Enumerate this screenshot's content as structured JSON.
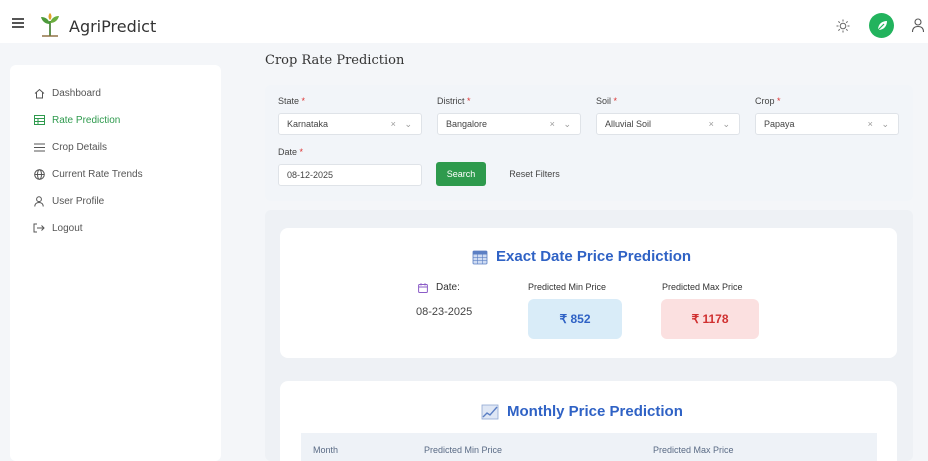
{
  "app": {
    "brand": "AgriPredict"
  },
  "icons": {
    "menu": "hamburger-icon",
    "logo": "sprout-icon",
    "theme": "sun-icon",
    "avatar": "plant-icon",
    "user": "user-icon"
  },
  "colors": {
    "accent_green": "#2e9a4d",
    "title_blue": "#2f62c5",
    "max_red": "#d03030"
  },
  "sidebar": {
    "items": [
      {
        "label": "Dashboard",
        "icon": "home-icon",
        "active": false
      },
      {
        "label": "Rate Prediction",
        "icon": "table-icon",
        "active": true
      },
      {
        "label": "Crop Details",
        "icon": "list-icon",
        "active": false
      },
      {
        "label": "Current Rate Trends",
        "icon": "globe-icon",
        "active": false
      },
      {
        "label": "User Profile",
        "icon": "user-icon",
        "active": false
      },
      {
        "label": "Logout",
        "icon": "logout-icon",
        "active": false
      }
    ]
  },
  "page": {
    "title": "Crop Rate Prediction"
  },
  "filters": {
    "state": {
      "label": "State",
      "value": "Karnataka"
    },
    "district": {
      "label": "District",
      "value": "Bangalore"
    },
    "soil": {
      "label": "Soil",
      "value": "Alluvial Soil"
    },
    "crop": {
      "label": "Crop",
      "value": "Papaya"
    },
    "date": {
      "label": "Date",
      "value": "08-12-2025"
    },
    "required_mark": "*",
    "clear_glyph": "×",
    "dropdown_glyph": "⌄",
    "search_label": "Search",
    "reset_label": "Reset Filters"
  },
  "exact": {
    "title": "Exact Date Price Prediction",
    "date_label": "Date:",
    "date_value": "08-23-2025",
    "min_label": "Predicted Min Price",
    "max_label": "Predicted Max Price",
    "min_value": "₹ 852",
    "max_value": "₹ 1178"
  },
  "monthly": {
    "title": "Monthly Price Prediction",
    "columns": [
      "Month",
      "Predicted Min Price",
      "Predicted Max Price"
    ]
  }
}
